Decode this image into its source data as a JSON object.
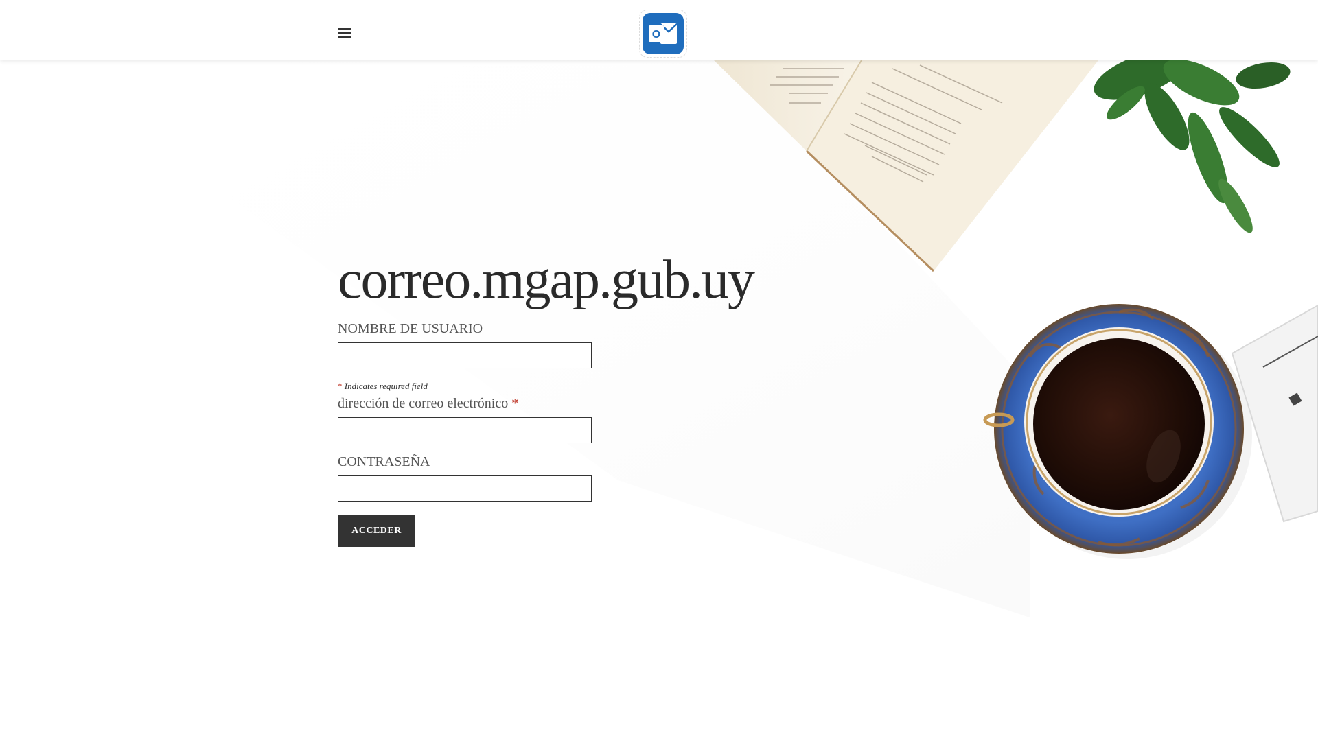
{
  "header": {
    "menu_icon": "hamburger-menu-icon",
    "logo_icon": "outlook-icon",
    "logo_letter": "O",
    "logo_color": "#1f6dbd"
  },
  "main": {
    "title": "correo.mgap.gub.uy",
    "username_label": "NOMBRE DE USUARIO",
    "username_value": "",
    "required_asterisk": "*",
    "required_note": "Indicates required field",
    "email_label": "dirección de correo electrónico",
    "email_value": "",
    "password_label": "CONTRASEÑA",
    "password_value": "",
    "submit_label": "ACCEDER"
  },
  "colors": {
    "text": "#333333",
    "button_bg": "#333333",
    "required": "#c0392b",
    "cup_blue": "#3d6fc6",
    "plant_green": "#2e6b2a"
  }
}
